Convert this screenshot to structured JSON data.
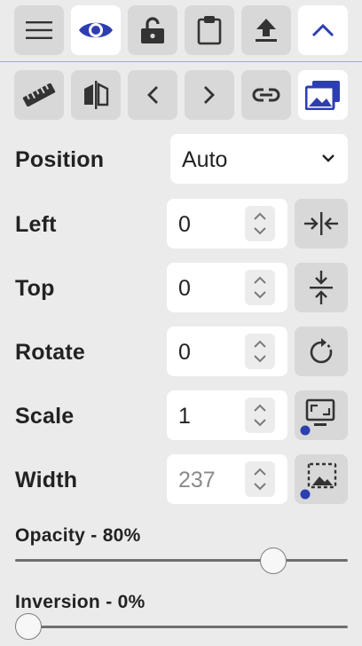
{
  "colors": {
    "accent": "#2d3fb0",
    "panel_bg": "#ebebeb",
    "button_bg": "#d8d8d8",
    "active_button_bg": "#ffffff"
  },
  "toolbar_top": [
    {
      "name": "menu-icon",
      "active": false
    },
    {
      "name": "eye-icon",
      "active": true
    },
    {
      "name": "unlock-icon",
      "active": false
    },
    {
      "name": "clipboard-icon",
      "active": false
    },
    {
      "name": "upload-icon",
      "active": false
    },
    {
      "name": "chevron-up-icon",
      "active": true
    }
  ],
  "toolbar_second": [
    {
      "name": "ruler-icon",
      "active": false
    },
    {
      "name": "flip-horizontal-icon",
      "active": false
    },
    {
      "name": "chevron-left-icon",
      "active": false
    },
    {
      "name": "chevron-right-icon",
      "active": false
    },
    {
      "name": "link-icon",
      "active": false
    },
    {
      "name": "images-icon",
      "active": true
    }
  ],
  "position": {
    "label": "Position",
    "value": "Auto",
    "options_visible": [
      "Auto"
    ]
  },
  "left": {
    "label": "Left",
    "value": "0",
    "button_icon": "center-horizontal-icon"
  },
  "top": {
    "label": "Top",
    "value": "0",
    "button_icon": "center-vertical-icon"
  },
  "rotate": {
    "label": "Rotate",
    "value": "0",
    "button_icon": "rotate-icon"
  },
  "scale": {
    "label": "Scale",
    "value": "1",
    "button_icon": "fit-screen-icon"
  },
  "width": {
    "label": "Width",
    "placeholder": "237",
    "button_icon": "fit-width-icon"
  },
  "opacity": {
    "label": "Opacity - 80%",
    "value": 80
  },
  "inversion": {
    "label": "Inversion - 0%",
    "value": 0
  }
}
